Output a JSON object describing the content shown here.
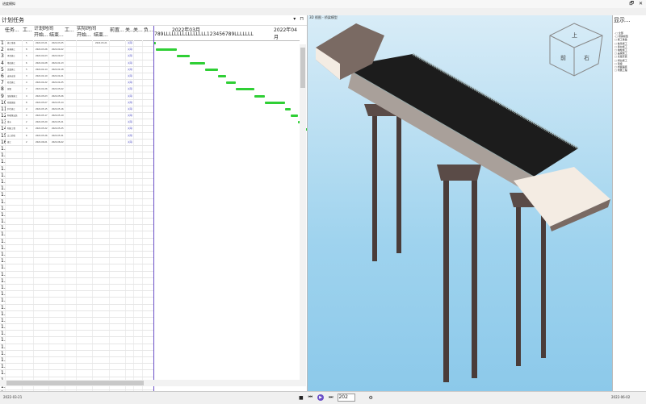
{
  "window": {
    "title": "进度模拟",
    "controls": [
      "🗗",
      "✕"
    ]
  },
  "plan_panel": {
    "title": "计划任务",
    "controls": [
      "▾",
      "⊓"
    ]
  },
  "table_headers": [
    "任务...",
    "工...",
    "计划时间",
    "开始...",
    "结束...",
    "工...",
    "实际时间",
    "开始...",
    "结束...",
    "前置...",
    "关...",
    "关...",
    "负..."
  ],
  "rows": [
    {
      "id": "1",
      "name": "施工准备",
      "dur": "5",
      "start": "2022-03-21",
      "end": "2022-03-25",
      "actual": "2022-03-21"
    },
    {
      "id": "2",
      "name": "桩基施工",
      "dur": "8",
      "start": "2022-03-26",
      "end": "2022-04-02",
      "actual": ""
    },
    {
      "id": "3",
      "name": "承台施工",
      "dur": "5",
      "start": "2022-04-03",
      "end": "2022-04-07",
      "actual": ""
    },
    {
      "id": "4",
      "name": "墩柱施工",
      "dur": "6",
      "start": "2022-04-08",
      "end": "2022-04-13",
      "actual": ""
    },
    {
      "id": "5",
      "name": "盖梁施工",
      "dur": "5",
      "start": "2022-04-14",
      "end": "2022-04-18",
      "actual": ""
    },
    {
      "id": "6",
      "name": "支座安装",
      "dur": "3",
      "start": "2022-04-19",
      "end": "2022-04-21",
      "actual": ""
    },
    {
      "id": "7",
      "name": "桥台施工",
      "dur": "4",
      "start": "2022-04-22",
      "end": "2022-04-25",
      "actual": ""
    },
    {
      "id": "8",
      "name": "架梁",
      "dur": "7",
      "start": "2022-04-26",
      "end": "2022-05-02",
      "actual": ""
    },
    {
      "id": "9",
      "name": "湿接缝施工",
      "dur": "4",
      "start": "2022-05-03",
      "end": "2022-05-06",
      "actual": ""
    },
    {
      "id": "10",
      "name": "桥面铺装",
      "dur": "8",
      "start": "2022-05-07",
      "end": "2022-05-14",
      "actual": ""
    },
    {
      "id": "11",
      "name": "护栏施工",
      "dur": "2",
      "start": "2022-05-15",
      "end": "2022-05-16",
      "actual": ""
    },
    {
      "id": "12",
      "name": "伸缩缝安装",
      "dur": "3",
      "start": "2022-05-17",
      "end": "2022-05-19",
      "actual": ""
    },
    {
      "id": "13",
      "name": "排水",
      "dur": "2",
      "start": "2022-05-20",
      "end": "2022-05-21",
      "actual": ""
    },
    {
      "id": "14",
      "name": "附属工程",
      "dur": "4",
      "start": "2022-05-22",
      "end": "2022-05-25",
      "actual": ""
    },
    {
      "id": "15",
      "name": "交工验收",
      "dur": "6",
      "start": "2022-05-26",
      "end": "2022-05-31",
      "actual": ""
    },
    {
      "id": "16",
      "name": "竣工",
      "dur": "2",
      "start": "2022-06-01",
      "end": "2022-06-02",
      "actual": ""
    }
  ],
  "link_label": "关联",
  "empty_row_count": 42,
  "gantt": {
    "month1": "2022年03月",
    "month2": "2022年04月",
    "day_strip": "789LLLLLLLLLLLLLLLL123456789LLLLLLL",
    "bar_color": "#2fcf35"
  },
  "viewport": {
    "title": "3D 视图 - 桥梁模型"
  },
  "props_panel": {
    "title": "显示...",
    "tree": [
      "-□ 全部",
      " -□ 桥梁模型",
      "  □ 施工准备",
      "  □ 桩基施工",
      "  □ 承台施工",
      "  □ 墩柱施工",
      "  □ 盖梁施工",
      "  □ 支座安装",
      "  □ 桥台施工",
      "  □ 架梁",
      "  □ 桥面铺装",
      "  □ 附属工程"
    ]
  },
  "status": {
    "start_date": "2022-03-21",
    "year": "202",
    "end_date": "2022-06-02",
    "settings": "⚙"
  }
}
